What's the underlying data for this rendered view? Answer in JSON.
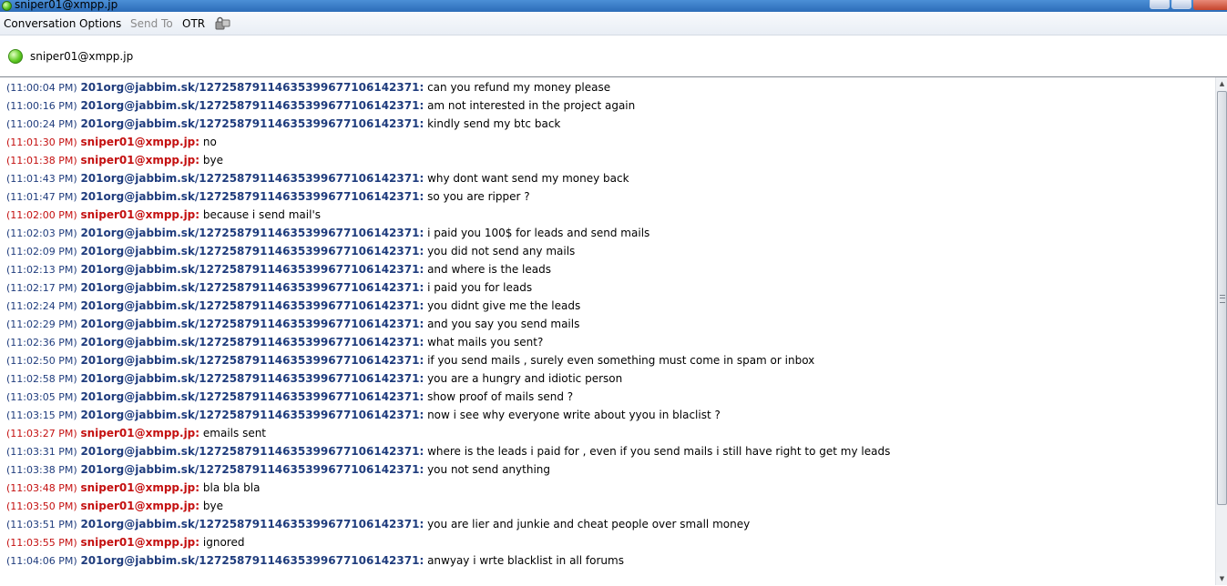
{
  "window": {
    "title": "sniper01@xmpp.jp"
  },
  "menu": {
    "conversation": "Conversation",
    "options": "Options",
    "send_to": "Send To",
    "otr": "OTR"
  },
  "contact": {
    "name": "sniper01@xmpp.jp",
    "status": "available"
  },
  "colors": {
    "them": "#1f3c7d",
    "me": "#c41010"
  },
  "messages": [
    {
      "time": "(11:00:04 PM)",
      "sender": "201org@jabbim.sk/127258791146353996771061423​71:",
      "text": "can you refund my money please",
      "from": "them"
    },
    {
      "time": "(11:00:16 PM)",
      "sender": "201org@jabbim.sk/12725879114635399677106142371:",
      "text": "am not interested in the project again",
      "from": "them"
    },
    {
      "time": "(11:00:24 PM)",
      "sender": "201org@jabbim.sk/12725879114635399677106142371:",
      "text": "kindly send my btc back",
      "from": "them"
    },
    {
      "time": "(11:01:30 PM)",
      "sender": "sniper01@xmpp.jp:",
      "text": "no",
      "from": "me"
    },
    {
      "time": "(11:01:38 PM)",
      "sender": "sniper01@xmpp.jp:",
      "text": "bye",
      "from": "me"
    },
    {
      "time": "(11:01:43 PM)",
      "sender": "201org@jabbim.sk/12725879114635399677106142371:",
      "text": "why dont want send my money back",
      "from": "them"
    },
    {
      "time": "(11:01:47 PM)",
      "sender": "201org@jabbim.sk/12725879114635399677106142371:",
      "text": "so you are ripper ?",
      "from": "them"
    },
    {
      "time": "(11:02:00 PM)",
      "sender": "sniper01@xmpp.jp:",
      "text": "because i send mail's",
      "from": "me"
    },
    {
      "time": "(11:02:03 PM)",
      "sender": "201org@jabbim.sk/12725879114635399677106142371:",
      "text": "i paid you 100$ for leads and send mails",
      "from": "them"
    },
    {
      "time": "(11:02:09 PM)",
      "sender": "201org@jabbim.sk/12725879114635399677106142371:",
      "text": "you did not send any mails",
      "from": "them"
    },
    {
      "time": "(11:02:13 PM)",
      "sender": "201org@jabbim.sk/12725879114635399677106142371:",
      "text": "and where is the leads",
      "from": "them"
    },
    {
      "time": "(11:02:17 PM)",
      "sender": "201org@jabbim.sk/12725879114635399677106142371:",
      "text": "i paid you for leads",
      "from": "them"
    },
    {
      "time": "(11:02:24 PM)",
      "sender": "201org@jabbim.sk/12725879114635399677106142371:",
      "text": "you didnt give me the leads",
      "from": "them"
    },
    {
      "time": "(11:02:29 PM)",
      "sender": "201org@jabbim.sk/12725879114635399677106142371:",
      "text": "and you say you send mails",
      "from": "them"
    },
    {
      "time": "(11:02:36 PM)",
      "sender": "201org@jabbim.sk/12725879114635399677106142371:",
      "text": "what mails you sent?",
      "from": "them"
    },
    {
      "time": "(11:02:50 PM)",
      "sender": "201org@jabbim.sk/12725879114635399677106142371:",
      "text": "if you send mails , surely even something must come in spam or inbox",
      "from": "them"
    },
    {
      "time": "(11:02:58 PM)",
      "sender": "201org@jabbim.sk/12725879114635399677106142371:",
      "text": "you are a hungry and idiotic person",
      "from": "them"
    },
    {
      "time": "(11:03:05 PM)",
      "sender": "201org@jabbim.sk/12725879114635399677106142371:",
      "text": "show proof of mails send ?",
      "from": "them"
    },
    {
      "time": "(11:03:15 PM)",
      "sender": "201org@jabbim.sk/12725879114635399677106142371:",
      "text": "now i see why everyone write about yyou in blaclist ?",
      "from": "them"
    },
    {
      "time": "(11:03:27 PM)",
      "sender": "sniper01@xmpp.jp:",
      "text": "emails sent",
      "from": "me"
    },
    {
      "time": "(11:03:31 PM)",
      "sender": "201org@jabbim.sk/12725879114635399677106142371:",
      "text": "where is the leads i paid for , even if you send mails i still have right to get my leads",
      "from": "them"
    },
    {
      "time": "(11:03:38 PM)",
      "sender": "201org@jabbim.sk/12725879114635399677106142371:",
      "text": "you not send anything",
      "from": "them"
    },
    {
      "time": "(11:03:48 PM)",
      "sender": "sniper01@xmpp.jp:",
      "text": "bla bla bla",
      "from": "me"
    },
    {
      "time": "(11:03:50 PM)",
      "sender": "sniper01@xmpp.jp:",
      "text": "bye",
      "from": "me"
    },
    {
      "time": "(11:03:51 PM)",
      "sender": "201org@jabbim.sk/12725879114635399677106142371:",
      "text": "you are lier and junkie and cheat people over small money",
      "from": "them"
    },
    {
      "time": "(11:03:55 PM)",
      "sender": "sniper01@xmpp.jp:",
      "text": "ignored",
      "from": "me"
    },
    {
      "time": "(11:04:06 PM)",
      "sender": "201org@jabbim.sk/12725879114635399677106142371:",
      "text": "anwyay i wrte blacklist in all forums",
      "from": "them"
    }
  ]
}
